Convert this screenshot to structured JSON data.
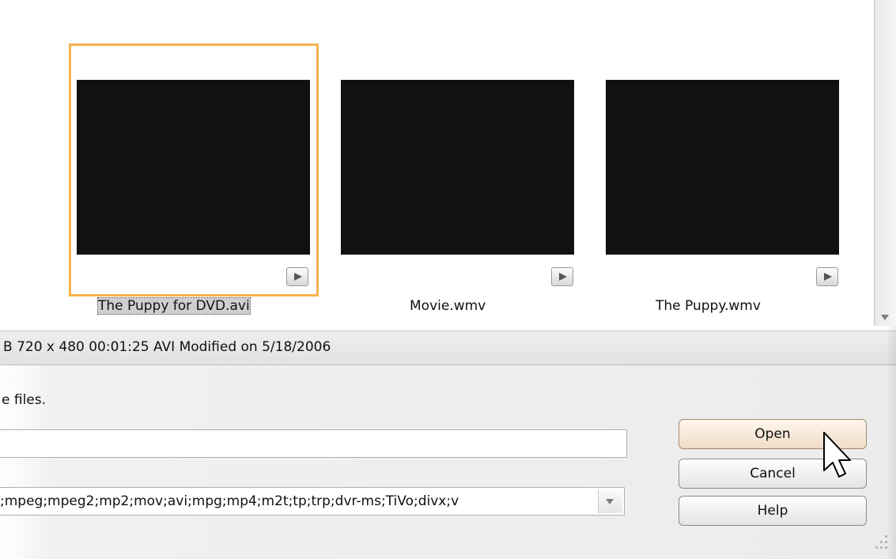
{
  "thumbnails": [
    {
      "caption": "The Puppy for DVD.avi",
      "selected": true
    },
    {
      "caption": "Movie.wmv",
      "selected": false
    },
    {
      "caption": "The Puppy.wmv",
      "selected": false
    }
  ],
  "info_bar": {
    "text": "B  720 x 480 00:01:25 AVI  Modified on 5/18/2006"
  },
  "hint": "e files.",
  "file_name_value": "",
  "file_type_value": ";mpeg;mpeg2;mp2;mov;avi;mpg;mp4;m2t;tp;trp;dvr-ms;TiVo;divx;v",
  "buttons": {
    "open": "Open",
    "cancel": "Cancel",
    "help": "Help"
  },
  "colors": {
    "selection_border": "#f6b24d",
    "video": "#111111"
  },
  "icons": {
    "play": "play-triangle-icon",
    "dropdown": "chevron-down-icon",
    "cursor": "arrow-cursor-icon"
  }
}
